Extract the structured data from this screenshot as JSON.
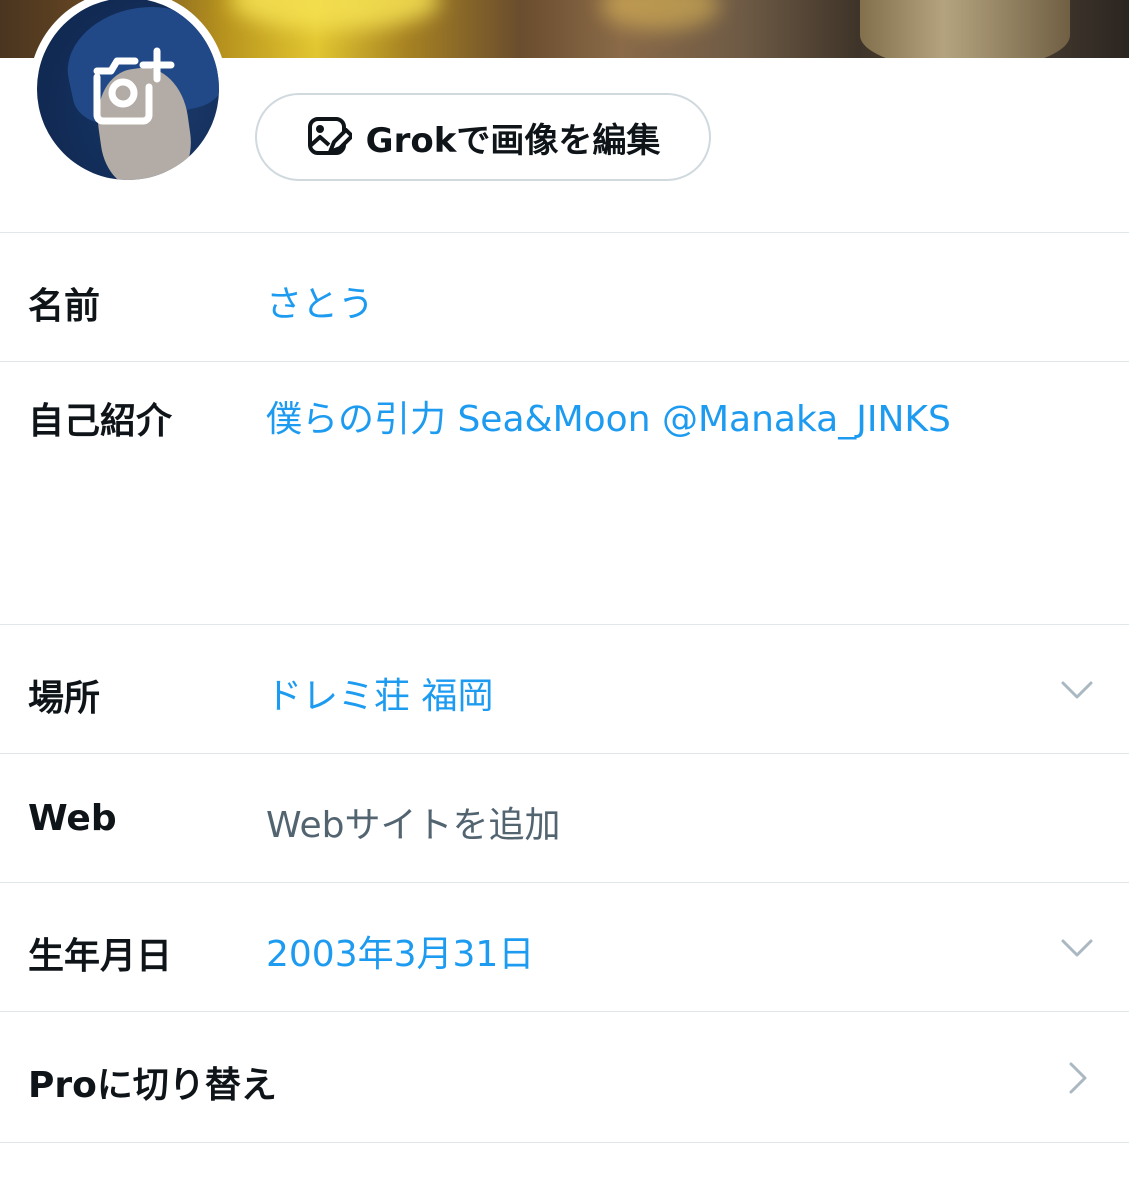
{
  "header": {
    "banner_icon": "banner-photo",
    "avatar_icon": "add-photo-camera-icon"
  },
  "grok_button": {
    "label": "Grokで画像を編集",
    "icon": "image-edit-icon"
  },
  "fields": {
    "name": {
      "label": "名前",
      "value": "さとう"
    },
    "bio": {
      "label": "自己紹介",
      "value": "僕らの引力 Sea&Moon @Manaka_JINKS"
    },
    "location": {
      "label": "場所",
      "value": "ドレミ荘 福岡",
      "icon": "chevron-down-icon"
    },
    "website": {
      "label": "Web",
      "placeholder": "Webサイトを追加"
    },
    "birthdate": {
      "label": "生年月日",
      "value": "2003年3月31日",
      "icon": "chevron-down-icon"
    },
    "pro": {
      "label": "Proに切り替え",
      "icon": "chevron-right-icon"
    }
  },
  "colors": {
    "accent": "#1d9bf0",
    "text": "#0f1419",
    "placeholder": "#536471",
    "divider": "#e1e6e9"
  }
}
